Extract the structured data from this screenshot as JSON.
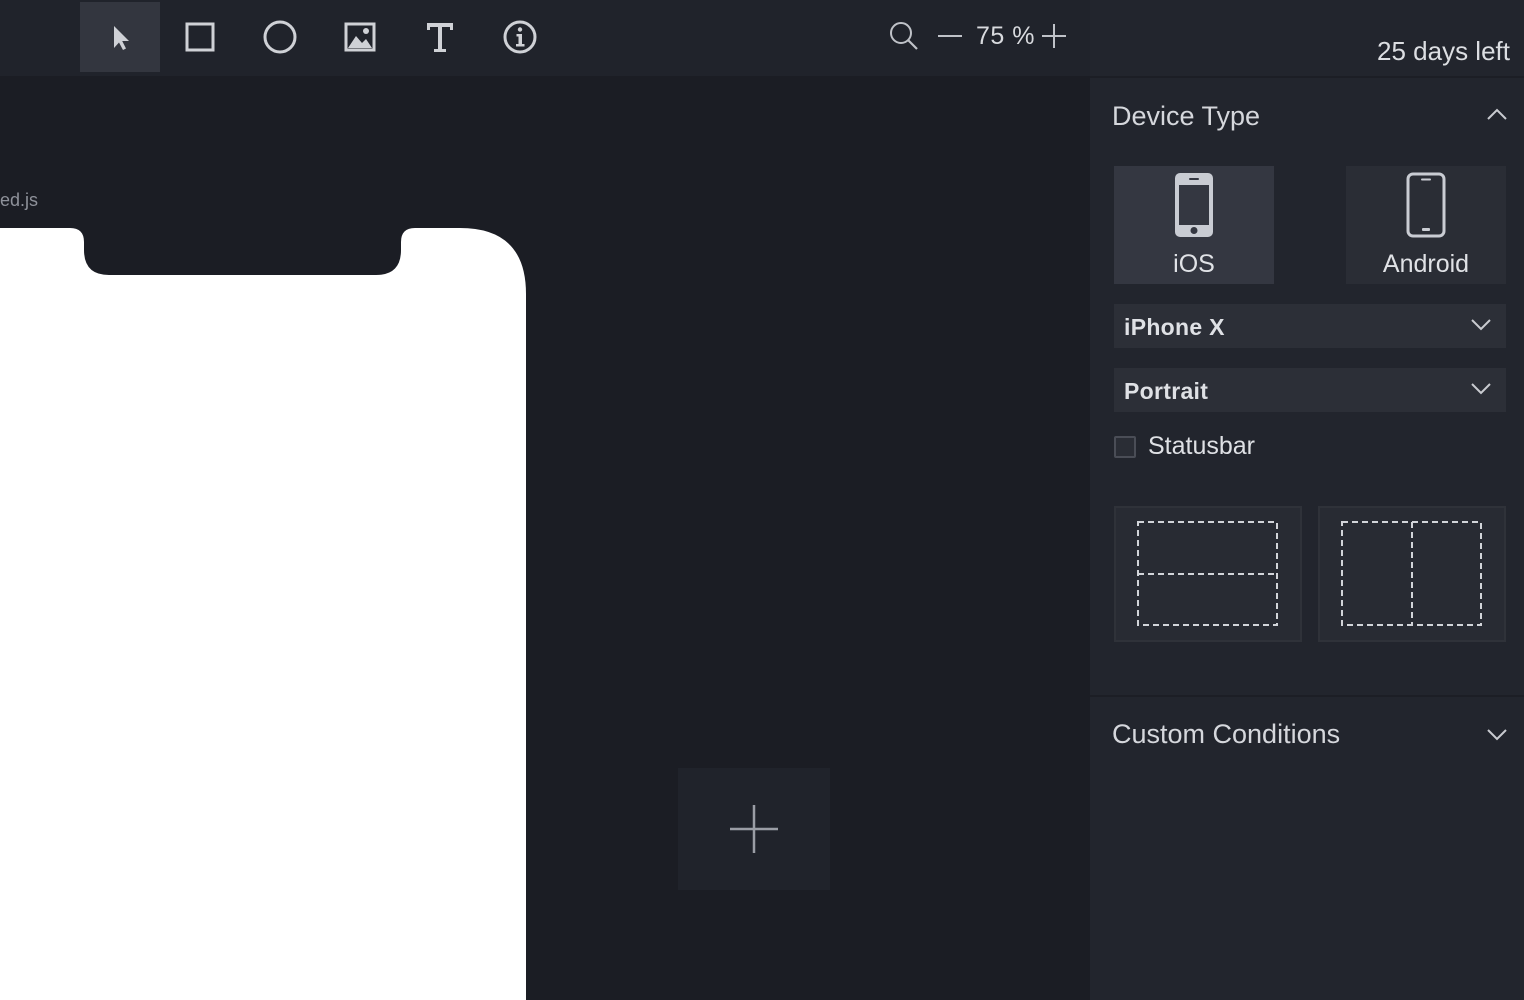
{
  "toolbar": {
    "tools": [
      {
        "name": "select-tool",
        "icon": "cursor-arrow-icon",
        "active": true
      },
      {
        "name": "rectangle-tool",
        "icon": "square-icon"
      },
      {
        "name": "ellipse-tool",
        "icon": "circle-icon"
      },
      {
        "name": "image-tool",
        "icon": "image-icon"
      },
      {
        "name": "text-tool",
        "icon": "text-t-icon"
      },
      {
        "name": "info-tool",
        "icon": "info-icon"
      }
    ],
    "zoom": {
      "value": "75 %",
      "zoom_out_icon": "minus-icon",
      "zoom_in_icon": "plus-icon",
      "search_icon": "magnifier-icon"
    }
  },
  "canvas": {
    "file_label": "ed.js",
    "add_frame_icon": "plus-icon"
  },
  "panel": {
    "trial_text": "25 days left",
    "device_section": {
      "title": "Device Type",
      "collapse_icon": "chevron-up-icon",
      "devices": [
        {
          "label": "iOS",
          "icon": "phone-ios-icon",
          "selected": true
        },
        {
          "label": "Android",
          "icon": "phone-android-icon",
          "selected": false
        }
      ],
      "model_select": {
        "value": "iPhone X"
      },
      "orientation_select": {
        "value": "Portrait"
      },
      "statusbar": {
        "label": "Statusbar",
        "checked": false
      },
      "layouts": [
        {
          "name": "split-horizontal",
          "icon": "split-horizontal-icon"
        },
        {
          "name": "split-vertical",
          "icon": "split-vertical-icon"
        }
      ]
    },
    "custom_section": {
      "title": "Custom Conditions",
      "expand_icon": "chevron-down-icon"
    }
  },
  "colors": {
    "app_bg": "#1b1d24",
    "toolbar_bg": "#20232b",
    "panel_bg": "#22252d",
    "active_tool": "#33363f",
    "text": "#d5d7dc"
  }
}
